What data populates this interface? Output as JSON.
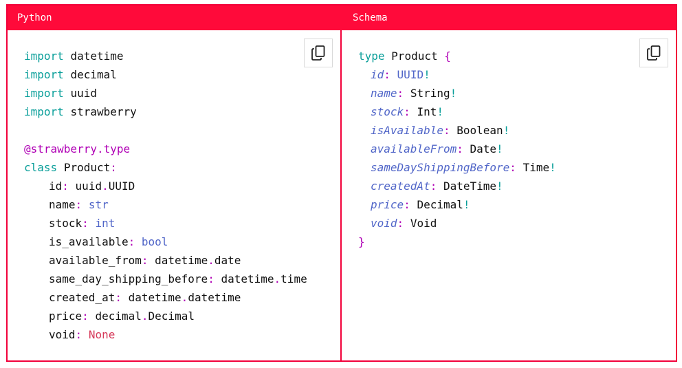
{
  "tabs": {
    "left": "Python",
    "right": "Schema"
  },
  "python": {
    "imports": [
      {
        "kw": "import",
        "mod": "datetime"
      },
      {
        "kw": "import",
        "mod": "decimal"
      },
      {
        "kw": "import",
        "mod": "uuid"
      },
      {
        "kw": "import",
        "mod": "strawberry"
      }
    ],
    "decorator": "@strawberry.type",
    "class_kw": "class",
    "class_name": "Product",
    "fields": [
      {
        "name": "id",
        "colon": ":",
        "type_parts": [
          "uuid",
          ".",
          "UUID"
        ]
      },
      {
        "name": "name",
        "colon": ":",
        "type": "str"
      },
      {
        "name": "stock",
        "colon": ":",
        "type": "int"
      },
      {
        "name": "is_available",
        "colon": ":",
        "type": "bool"
      },
      {
        "name": "available_from",
        "colon": ":",
        "type_parts": [
          "datetime",
          ".",
          "date"
        ]
      },
      {
        "name": "same_day_shipping_before",
        "colon": ":",
        "type_parts": [
          "datetime",
          ".",
          "time"
        ]
      },
      {
        "name": "created_at",
        "colon": ":",
        "type_parts": [
          "datetime",
          ".",
          "datetime"
        ]
      },
      {
        "name": "price",
        "colon": ":",
        "type_parts": [
          "decimal",
          ".",
          "Decimal"
        ]
      },
      {
        "name": "void",
        "colon": ":",
        "type": "None"
      }
    ]
  },
  "schema": {
    "type_kw": "type",
    "type_name": "Product",
    "open_brace": "{",
    "close_brace": "}",
    "fields": [
      {
        "name": "id",
        "type": "UUID",
        "bang": "!"
      },
      {
        "name": "name",
        "type": "String",
        "bang": "!"
      },
      {
        "name": "stock",
        "type": "Int",
        "bang": "!"
      },
      {
        "name": "isAvailable",
        "type": "Boolean",
        "bang": "!"
      },
      {
        "name": "availableFrom",
        "type": "Date",
        "bang": "!"
      },
      {
        "name": "sameDayShippingBefore",
        "type": "Time",
        "bang": "!"
      },
      {
        "name": "createdAt",
        "type": "DateTime",
        "bang": "!"
      },
      {
        "name": "price",
        "type": "Decimal",
        "bang": "!"
      },
      {
        "name": "void",
        "type": "Void",
        "bang": ""
      }
    ]
  },
  "icons": {
    "copy": "copy-icon"
  },
  "colors": {
    "accent": "#ff0a3a",
    "keyword": "#0b9f9a",
    "decorator": "#b000b5",
    "builtin_type": "#5166c8",
    "none": "#d63a5a"
  }
}
